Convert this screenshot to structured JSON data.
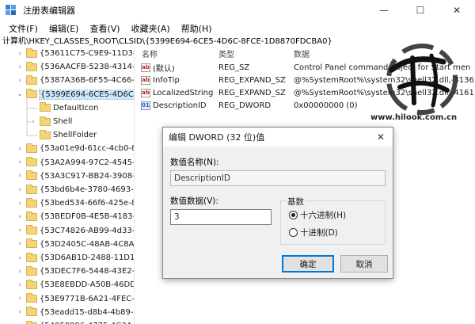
{
  "window": {
    "title": "注册表编辑器",
    "controls": {
      "minimize": "—",
      "maximize": "☐",
      "close": "✕"
    }
  },
  "menu": [
    "文件(F)",
    "编辑(E)",
    "查看(V)",
    "收藏夹(A)",
    "帮助(H)"
  ],
  "address": "计算机\\HKEY_CLASSES_ROOT\\CLSID\\{5399E694-6CE5-4D6C-8FCE-1D8870FDCBA0}",
  "tree": {
    "items": [
      {
        "label": "{53611C75-C9E9-11D3-80",
        "level": 0,
        "chevron": ">"
      },
      {
        "label": "{536AACFB-5238-4314-B4",
        "level": 0,
        "chevron": ">"
      },
      {
        "label": "{5387A36B-6F55-4C66-B0",
        "level": 0,
        "chevron": ">"
      },
      {
        "label": "{5399E694-6CE5-4D6C-8F",
        "level": 0,
        "chevron": "v",
        "selected": true
      },
      {
        "label": "DefaultIcon",
        "level": 1,
        "chevron": ""
      },
      {
        "label": "Shell",
        "level": 1,
        "chevron": ">"
      },
      {
        "label": "ShellFolder",
        "level": 1,
        "chevron": ""
      },
      {
        "label": "{53a01e9d-61cc-4cb0-83b",
        "level": 0,
        "chevron": ">"
      },
      {
        "label": "{53A2A994-97C2-4545-A9",
        "level": 0,
        "chevron": ">"
      },
      {
        "label": "{53A3C917-BB24-3908-B5",
        "level": 0,
        "chevron": ">"
      },
      {
        "label": "{53bd6b4e-3780-4693-afc",
        "level": 0,
        "chevron": ">"
      },
      {
        "label": "{53bed534-66f6-425e-8b7",
        "level": 0,
        "chevron": ">"
      },
      {
        "label": "{53BEDF0B-4E5B-4183-8D",
        "level": 0,
        "chevron": ">"
      },
      {
        "label": "{53C74826-AB99-4d33-AC",
        "level": 0,
        "chevron": ">"
      },
      {
        "label": "{53D2405C-48AB-4C8A-8F",
        "level": 0,
        "chevron": ">"
      },
      {
        "label": "{53D6AB1D-2488-11D1-A",
        "level": 0,
        "chevron": ">"
      },
      {
        "label": "{53DEC7F6-5448-43E2-95",
        "level": 0,
        "chevron": ">"
      },
      {
        "label": "{53E8EBDD-A50B-46DD-9",
        "level": 0,
        "chevron": ">"
      },
      {
        "label": "{53E9771B-6A21-4FEC-B8",
        "level": 0,
        "chevron": ">"
      },
      {
        "label": "{53eadd15-d8b4-4b89-9c",
        "level": 0,
        "chevron": ">"
      },
      {
        "label": "{54058896-4775-4C34-8B",
        "level": 0,
        "chevron": ">"
      }
    ]
  },
  "values": {
    "headers": [
      "名称",
      "类型",
      "数据"
    ],
    "rows": [
      {
        "icon": "ab",
        "name": "(默认)",
        "type": "REG_SZ",
        "data": "Control Panel command object for Start men"
      },
      {
        "icon": "ab",
        "name": "InfoTip",
        "type": "REG_EXPAND_SZ",
        "data": "@%SystemRoot%\\system32\\shell32.dll,-31361"
      },
      {
        "icon": "ab",
        "name": "LocalizedString",
        "type": "REG_EXPAND_SZ",
        "data": "@%SystemRoot%\\system32\\shell32.dll,-4161"
      },
      {
        "icon": "bin",
        "name": "DescriptionID",
        "type": "REG_DWORD",
        "data": "0x00000000 (0)"
      }
    ]
  },
  "dialog": {
    "title": "编辑 DWORD (32 位)值",
    "close": "✕",
    "name_label": "数值名称(N):",
    "name_value": "DescriptionID",
    "data_label": "数值数据(V):",
    "data_value": "3",
    "base_label": "基数",
    "hex_label": "十六进制(H)",
    "dec_label": "十进制(D)",
    "ok": "确定",
    "cancel": "取消"
  },
  "watermark": {
    "text": "www.hilook.com.cn"
  },
  "colors": {
    "selection": "#cce8ff",
    "folder": "#f4d47a",
    "default_button_border": "#0078d7"
  }
}
